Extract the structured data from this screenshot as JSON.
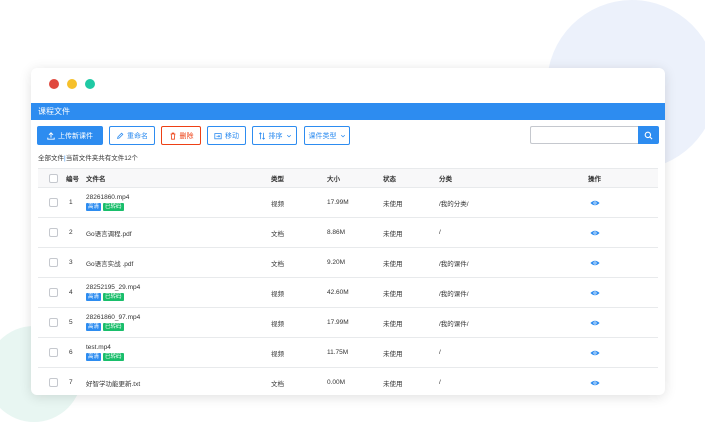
{
  "window": {
    "dot_colors": [
      "#e0483e",
      "#f6c02b",
      "#1fc9a4"
    ]
  },
  "title": "课程文件",
  "toolbar": {
    "upload_label": "上传新课件",
    "rename_label": "重命名",
    "delete_label": "删除",
    "move_label": "移动",
    "sort_label": "排序",
    "type_label": "课件类型",
    "search_placeholder": ""
  },
  "breadcrumb": {
    "root": "全部文件",
    "separator": "|",
    "info": "当前文件夹共有文件12个"
  },
  "table": {
    "headers": {
      "index": "编号",
      "name": "文件名",
      "type": "类型",
      "size": "大小",
      "status": "状态",
      "category": "分类",
      "action": "操作"
    },
    "rows": [
      {
        "index": "1",
        "name": "28261860.mp4",
        "tags": [
          "高清",
          "已转码"
        ],
        "type": "视频",
        "size": "17.99M",
        "status": "未使用",
        "category": "/我的分类/"
      },
      {
        "index": "2",
        "name": "Go语言调程.pdf",
        "tags": [],
        "type": "文档",
        "size": "8.86M",
        "status": "未使用",
        "category": "/"
      },
      {
        "index": "3",
        "name": "Go语言实战 .pdf",
        "tags": [],
        "type": "文档",
        "size": "9.20M",
        "status": "未使用",
        "category": "/我的课件/"
      },
      {
        "index": "4",
        "name": "28252195_29.mp4",
        "tags": [
          "高清",
          "已转码"
        ],
        "type": "视频",
        "size": "42.60M",
        "status": "未使用",
        "category": "/我的课件/"
      },
      {
        "index": "5",
        "name": "28261860_97.mp4",
        "tags": [
          "高清",
          "已转码"
        ],
        "type": "视频",
        "size": "17.99M",
        "status": "未使用",
        "category": "/我的课件/"
      },
      {
        "index": "6",
        "name": "test.mp4",
        "tags": [
          "高清",
          "已转码"
        ],
        "type": "视频",
        "size": "11.75M",
        "status": "未使用",
        "category": "/"
      },
      {
        "index": "7",
        "name": "好智学功能更新.txt",
        "tags": [],
        "type": "文档",
        "size": "0.00M",
        "status": "未使用",
        "category": "/"
      }
    ]
  },
  "colors": {
    "accent": "#2d8cf0",
    "danger": "#ed4014",
    "success": "#19be6b"
  }
}
